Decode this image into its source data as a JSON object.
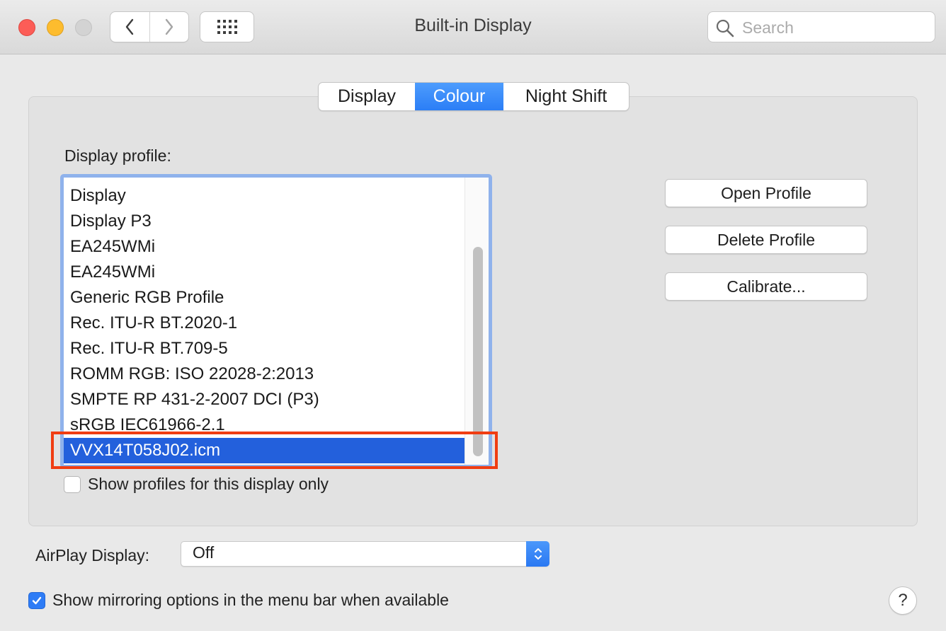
{
  "window": {
    "title": "Built-in Display",
    "search_placeholder": "Search"
  },
  "toolbar": {
    "back_icon": "chevron-left-icon",
    "forward_icon": "chevron-right-icon",
    "grid_icon": "grid-icon"
  },
  "tabs": [
    {
      "label": "Display",
      "active": false
    },
    {
      "label": "Colour",
      "active": true
    },
    {
      "label": "Night Shift",
      "active": false
    }
  ],
  "profile": {
    "label": "Display profile:",
    "items": [
      "Display",
      "Display P3",
      "EA245WMi",
      "EA245WMi",
      "Generic RGB Profile",
      "Rec. ITU-R BT.2020-1",
      "Rec. ITU-R BT.709-5",
      "ROMM RGB: ISO 22028-2:2013",
      "SMPTE RP 431-2-2007 DCI (P3)",
      "sRGB IEC61966-2.1",
      "VVX14T058J02.icm"
    ],
    "selected": "VVX14T058J02.icm",
    "show_only_label": "Show profiles for this display only",
    "show_only_checked": false
  },
  "buttons": {
    "open": "Open Profile",
    "delete": "Delete Profile",
    "calibrate": "Calibrate..."
  },
  "airplay": {
    "label": "AirPlay Display:",
    "value": "Off"
  },
  "mirroring": {
    "label": "Show mirroring options in the menu bar when available",
    "checked": true
  },
  "help": {
    "label": "?"
  },
  "colors": {
    "accent": "#2e7cf6",
    "selection": "#2360dc",
    "highlight_box": "#f03d12"
  }
}
